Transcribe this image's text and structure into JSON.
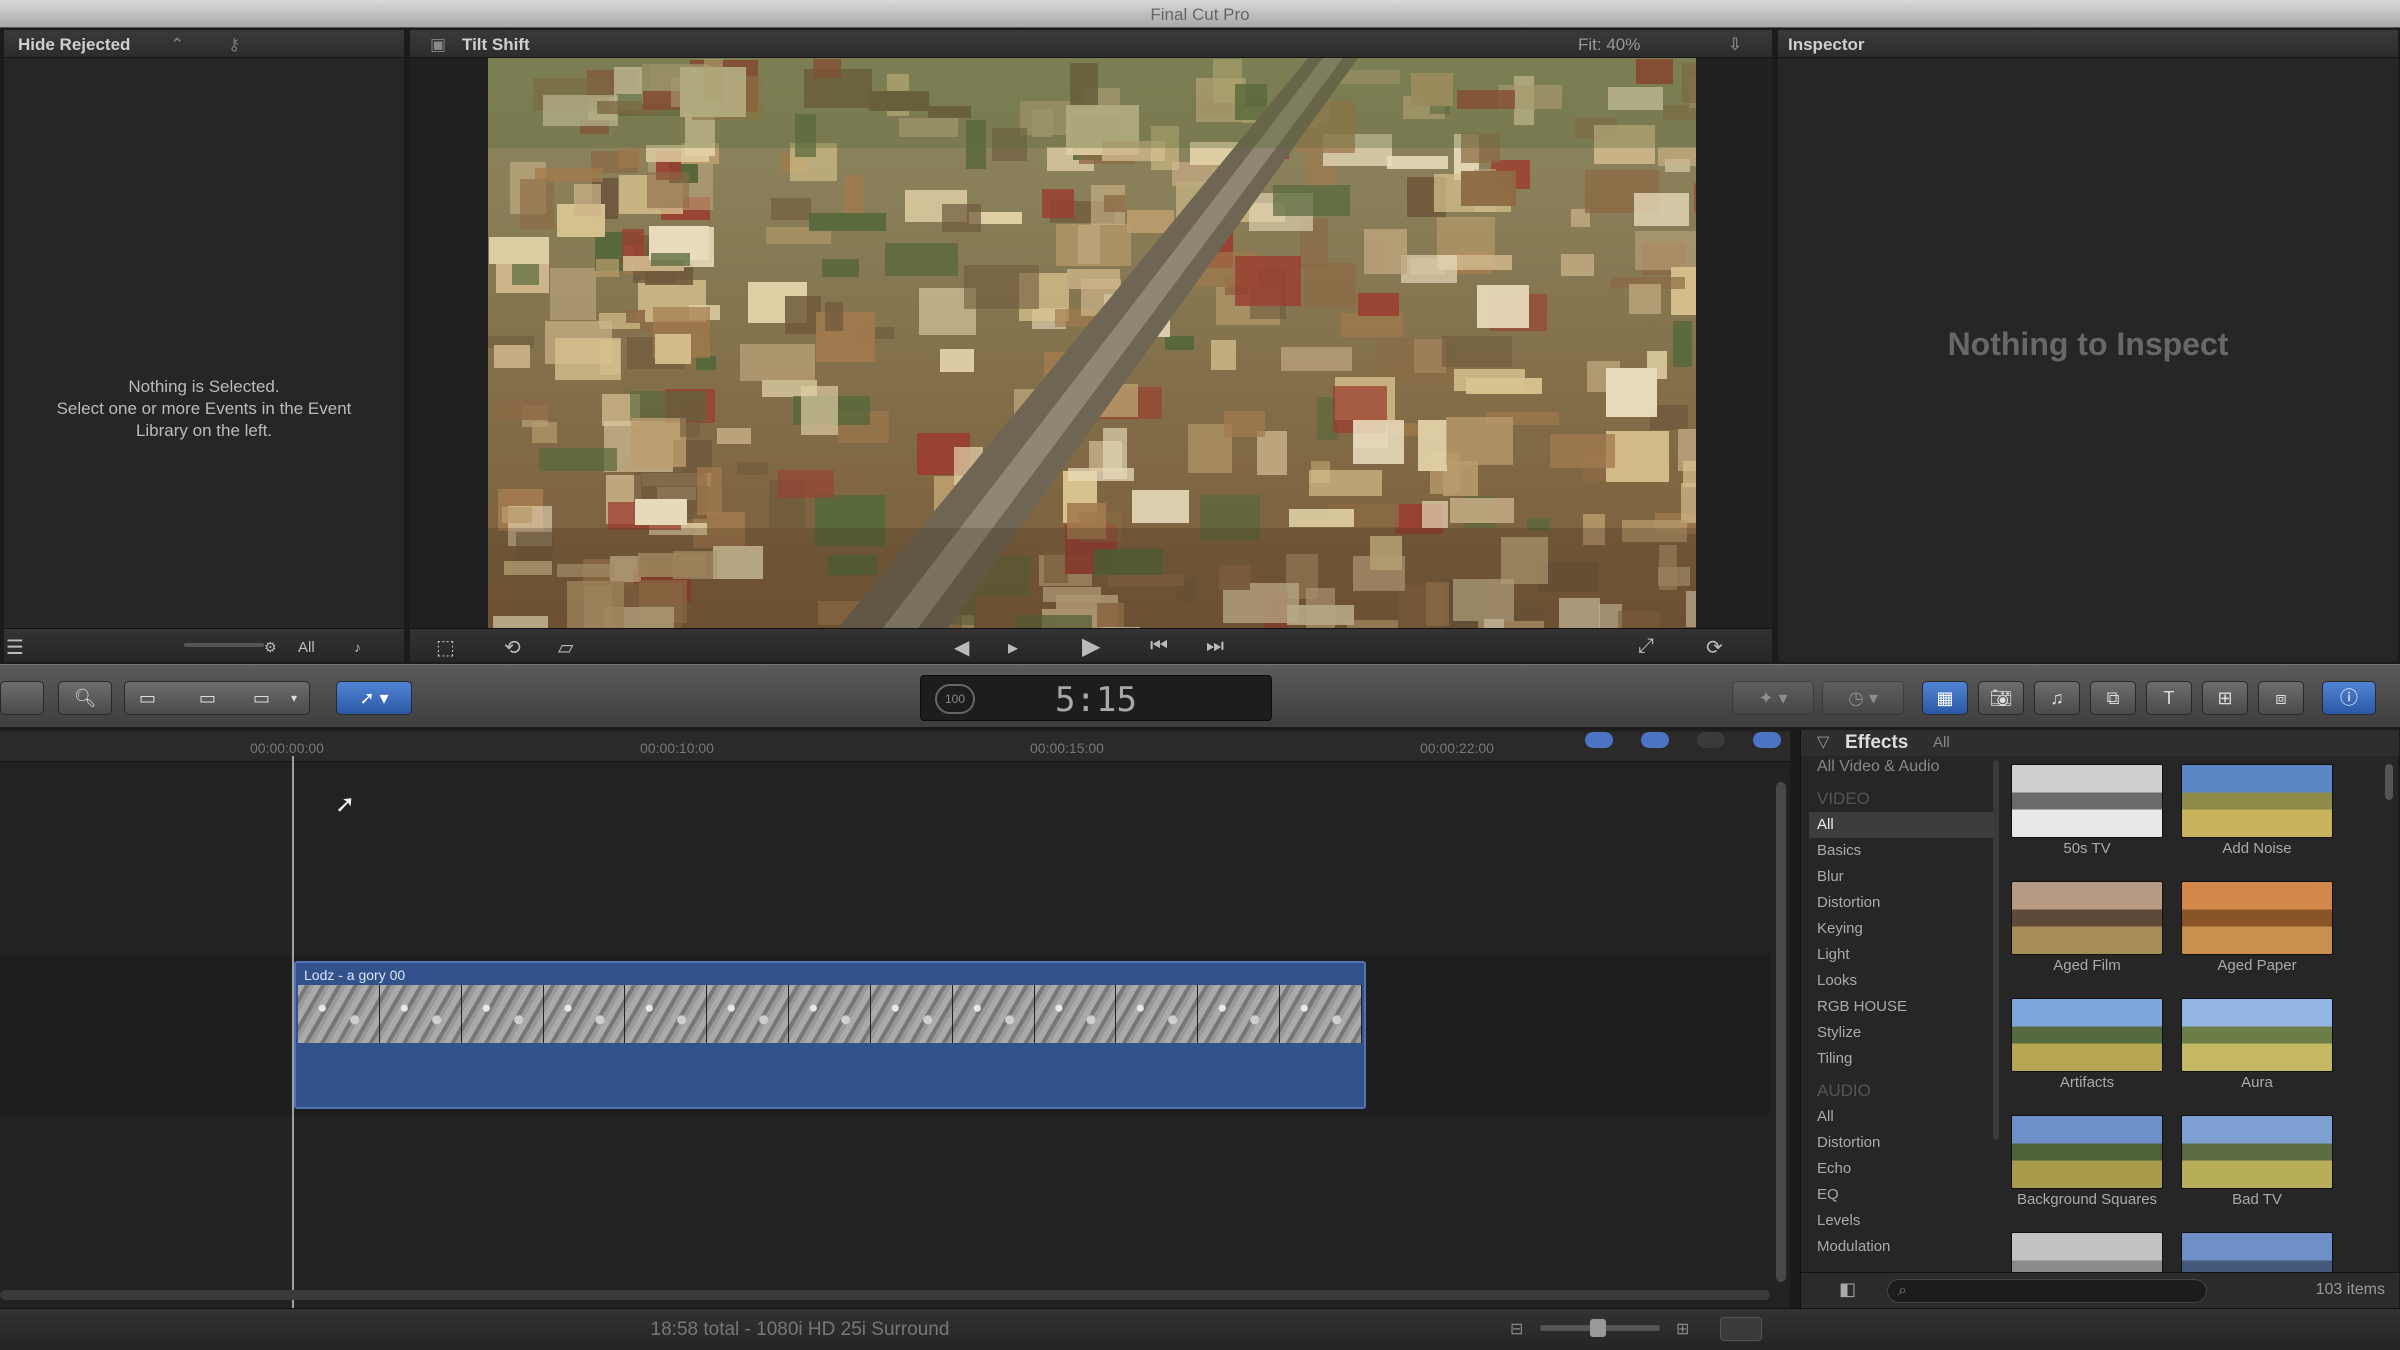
{
  "window": {
    "title": "Final Cut Pro"
  },
  "browser": {
    "header": "Hide Rejected",
    "empty_line1": "Nothing is Selected.",
    "empty_line2": "Select one or more Events in the Event",
    "empty_line3": "Library on the left.",
    "filter_value": "All"
  },
  "viewer": {
    "clip_name": "Tilt Shift",
    "zoom": "Fit: 40%"
  },
  "inspector": {
    "header": "Inspector",
    "empty_message": "Nothing to Inspect"
  },
  "toolbar": {
    "timecode": "5:15"
  },
  "timeline": {
    "clip_title": "Lodz - a gory 00"
  },
  "effects": {
    "title": "Effects",
    "all_label": "All",
    "top_category": "All Video & Audio",
    "video_section": "VIDEO",
    "video_categories": [
      "All",
      "Basics",
      "Blur",
      "Distortion",
      "Keying",
      "Light",
      "Looks",
      "RGB HOUSE",
      "Stylize",
      "Tiling"
    ],
    "audio_section": "AUDIO",
    "audio_categories": [
      "All",
      "Distortion",
      "Echo",
      "EQ",
      "Levels",
      "Modulation"
    ],
    "items": [
      {
        "label": "50s TV",
        "colors": [
          "#cfcfcf",
          "#6a6a6a",
          "#e8e8e8"
        ]
      },
      {
        "label": "Add Noise",
        "colors": [
          "#5d86c4",
          "#8e8a4a",
          "#c7b35a"
        ]
      },
      {
        "label": "Aged Film",
        "colors": [
          "#b79a83",
          "#5f4a3a",
          "#a78c55"
        ]
      },
      {
        "label": "Aged Paper",
        "colors": [
          "#d1884a",
          "#8a5526",
          "#c98f4f"
        ]
      },
      {
        "label": "Artifacts",
        "colors": [
          "#7fa6da",
          "#556b3e",
          "#b6a654"
        ]
      },
      {
        "label": "Aura",
        "colors": [
          "#93b6e6",
          "#6b7e47",
          "#c4b864"
        ]
      },
      {
        "label": "Background Squares",
        "colors": [
          "#6e90c9",
          "#4e6138",
          "#a89b4c"
        ]
      },
      {
        "label": "Bad TV",
        "colors": [
          "#7e9fd2",
          "#5a6c40",
          "#b8ad58"
        ]
      },
      {
        "label": "",
        "colors": [
          "#c2c2c2",
          "#8a8a8a",
          "#dddddd"
        ]
      },
      {
        "label": "",
        "colors": [
          "#6f8fc8",
          "#44587a",
          "#9cb2d8"
        ]
      }
    ],
    "item_count": "103 items"
  },
  "status": {
    "text": "18:58 total - 1080i HD 25i Surround"
  }
}
